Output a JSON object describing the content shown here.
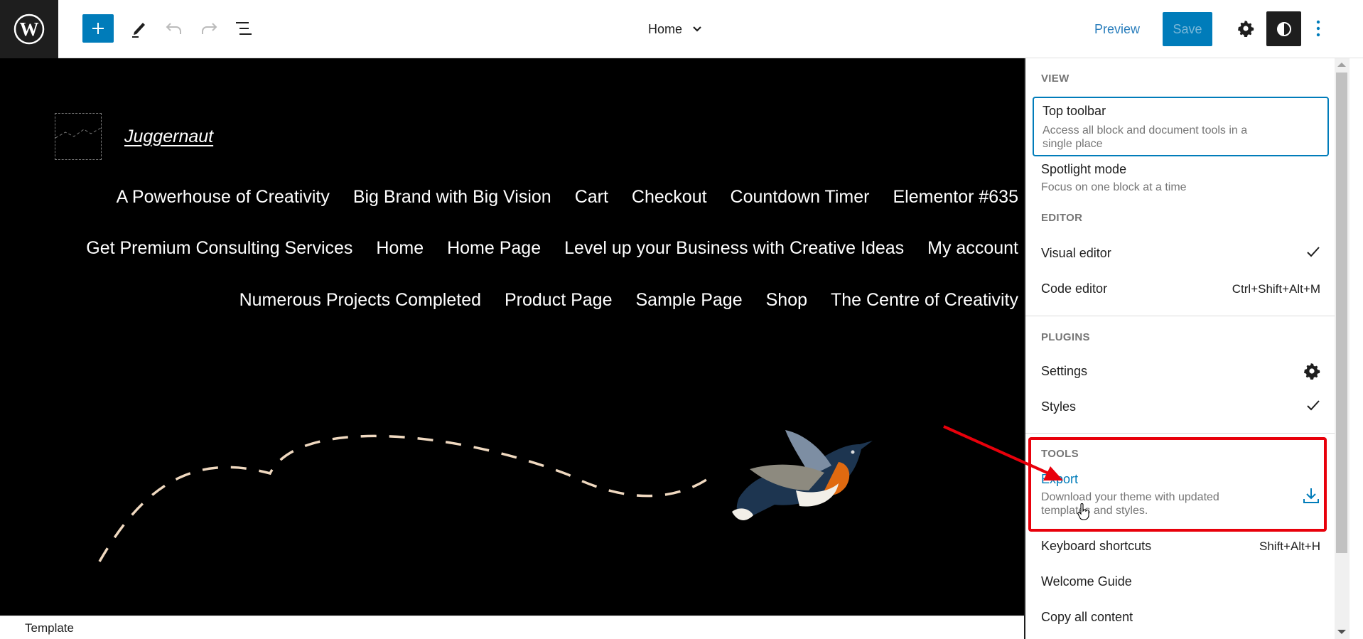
{
  "header": {
    "logo_icon": "wordpress-logo-icon",
    "add_block_icon": "plus-icon",
    "tools_icon": "pencil-icon",
    "undo_icon": "undo-icon",
    "redo_icon": "redo-icon",
    "list_view_icon": "list-view-icon",
    "document_title": "Home",
    "document_title_icon": "chevron-down-icon",
    "preview_label": "Preview",
    "save_label": "Save",
    "settings_icon": "gear-icon",
    "styles_icon": "half-circle-contrast-icon",
    "options_icon": "vertical-ellipsis-icon"
  },
  "canvas": {
    "site_logo_placeholder_icon": "image-placeholder-icon",
    "site_title": "Juggernaut",
    "nav_rows": [
      [
        "A Powerhouse of Creativity",
        "Big Brand with Big Vision",
        "Cart",
        "Checkout",
        "Countdown Timer",
        "Elementor #635"
      ],
      [
        "Get Premium Consulting Services",
        "Home",
        "Home Page",
        "Level up your Business with Creative Ideas",
        "My account"
      ],
      [
        "Numerous Projects Completed",
        "Product Page",
        "Sample Page",
        "Shop",
        "The Centre of Creativity"
      ]
    ],
    "hero_image": "flying-bird-with-dashed-trail"
  },
  "footer": {
    "breadcrumb": "Template"
  },
  "options_menu": {
    "groups": {
      "view": {
        "label": "VIEW",
        "items": [
          {
            "label": "Top toolbar",
            "description": "Access all block and document tools in a single place",
            "description_line1": "Access all block and document tools in a",
            "description_line2": "single place"
          },
          {
            "label": "Spotlight mode",
            "description": "Focus on one block at a time"
          }
        ]
      },
      "editor": {
        "label": "EDITOR",
        "items": [
          {
            "label": "Visual editor",
            "checked": true,
            "icon": "checkmark-icon"
          },
          {
            "label": "Code editor",
            "shortcut": "Ctrl+Shift+Alt+M"
          }
        ]
      },
      "plugins": {
        "label": "PLUGINS",
        "items": [
          {
            "label": "Settings",
            "icon": "gear-icon"
          },
          {
            "label": "Styles",
            "checked": true,
            "icon": "checkmark-icon"
          }
        ]
      },
      "tools": {
        "label": "TOOLS",
        "items": [
          {
            "label": "Export",
            "description": "Download your theme with updated templates and styles.",
            "description_line1": "Download your theme with updated",
            "description_line2": "templates and styles.",
            "icon": "download-icon"
          },
          {
            "label": "Keyboard shortcuts",
            "shortcut": "Shift+Alt+H"
          },
          {
            "label": "Welcome Guide"
          },
          {
            "label": "Copy all content"
          }
        ]
      }
    }
  },
  "annotation": {
    "highlight_color": "#e8000b",
    "target": "Export"
  },
  "colors": {
    "accent": "#007cba",
    "header_dark": "#1e1e1e",
    "canvas_bg": "#000000",
    "muted_text": "#757575"
  }
}
